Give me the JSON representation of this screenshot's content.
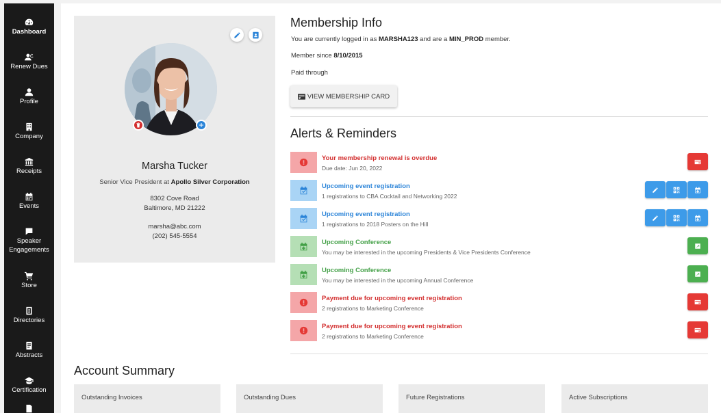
{
  "nav": [
    {
      "label": "Dashboard",
      "icon": "dashboard-icon",
      "active": true
    },
    {
      "label": "Renew Dues",
      "icon": "renew-dues-icon"
    },
    {
      "label": "Profile",
      "icon": "profile-icon"
    },
    {
      "label": "Company",
      "icon": "company-icon"
    },
    {
      "label": "Receipts",
      "icon": "receipts-icon"
    },
    {
      "label": "Events",
      "icon": "events-icon"
    },
    {
      "label": "Speaker Engagements",
      "icon": "speaker-icon"
    },
    {
      "label": "Store",
      "icon": "store-cart-icon"
    },
    {
      "label": "Directories",
      "icon": "directories-icon"
    },
    {
      "label": "Abstracts",
      "icon": "abstracts-icon"
    },
    {
      "label": "Certification",
      "icon": "certification-icon"
    }
  ],
  "profile": {
    "name": "Marsha Tucker",
    "title_prefix": "Senior Vice President at",
    "company": "Apollo Silver Corporation",
    "address1": "8302 Cove Road",
    "address2": "Baltimore, MD 21222",
    "email": "marsha@abc.com",
    "phone": "(202) 545-5554"
  },
  "membership": {
    "title": "Membership Info",
    "logged_prefix": "You are currently logged in as",
    "username": "MARSHA123",
    "logged_mid": "and are a",
    "level": "MIN_PROD",
    "logged_suffix": "member.",
    "since_prefix": "Member since",
    "since_date": "8/10/2015",
    "paid_through": "Paid through",
    "card_button": "VIEW MEMBERSHIP CARD"
  },
  "alerts_title": "Alerts & Reminders",
  "alerts": [
    {
      "title": "Your membership renewal is overdue",
      "sub": "Due date: Jun 20, 2022",
      "kind": "red"
    },
    {
      "title": "Upcoming event registration",
      "sub": "1 registrations to CBA Cocktail and Networking 2022",
      "kind": "blue"
    },
    {
      "title": "Upcoming event registration",
      "sub": "1 registrations to 2018 Posters on the Hill",
      "kind": "blue"
    },
    {
      "title": "Upcoming Conference",
      "sub": "You may be interested in the upcoming Presidents & Vice Presidents Conference",
      "kind": "green"
    },
    {
      "title": "Upcoming Conference",
      "sub": "You may be interested in the upcoming Annual Conference",
      "kind": "green"
    },
    {
      "title": "Payment due for upcoming event registration",
      "sub": "2 registrations to Marketing Conference",
      "kind": "red"
    },
    {
      "title": "Payment due for upcoming event registration",
      "sub": "2 registrations to Marketing Conference",
      "kind": "red"
    }
  ],
  "colors": {
    "red": "#d32f2f",
    "red_bg": "#f4a6a8",
    "red_btn": "#e53935",
    "blue": "#2b84d8",
    "blue_bg": "#a9d4f5",
    "blue_btn": "#3d9be9",
    "green": "#43a047",
    "green_bg": "#b5dfb5",
    "green_btn": "#4caf50"
  },
  "account_summary": {
    "title": "Account Summary",
    "boxes": [
      "Outstanding Invoices",
      "Outstanding Dues",
      "Future Registrations",
      "Active Subscriptions"
    ]
  }
}
